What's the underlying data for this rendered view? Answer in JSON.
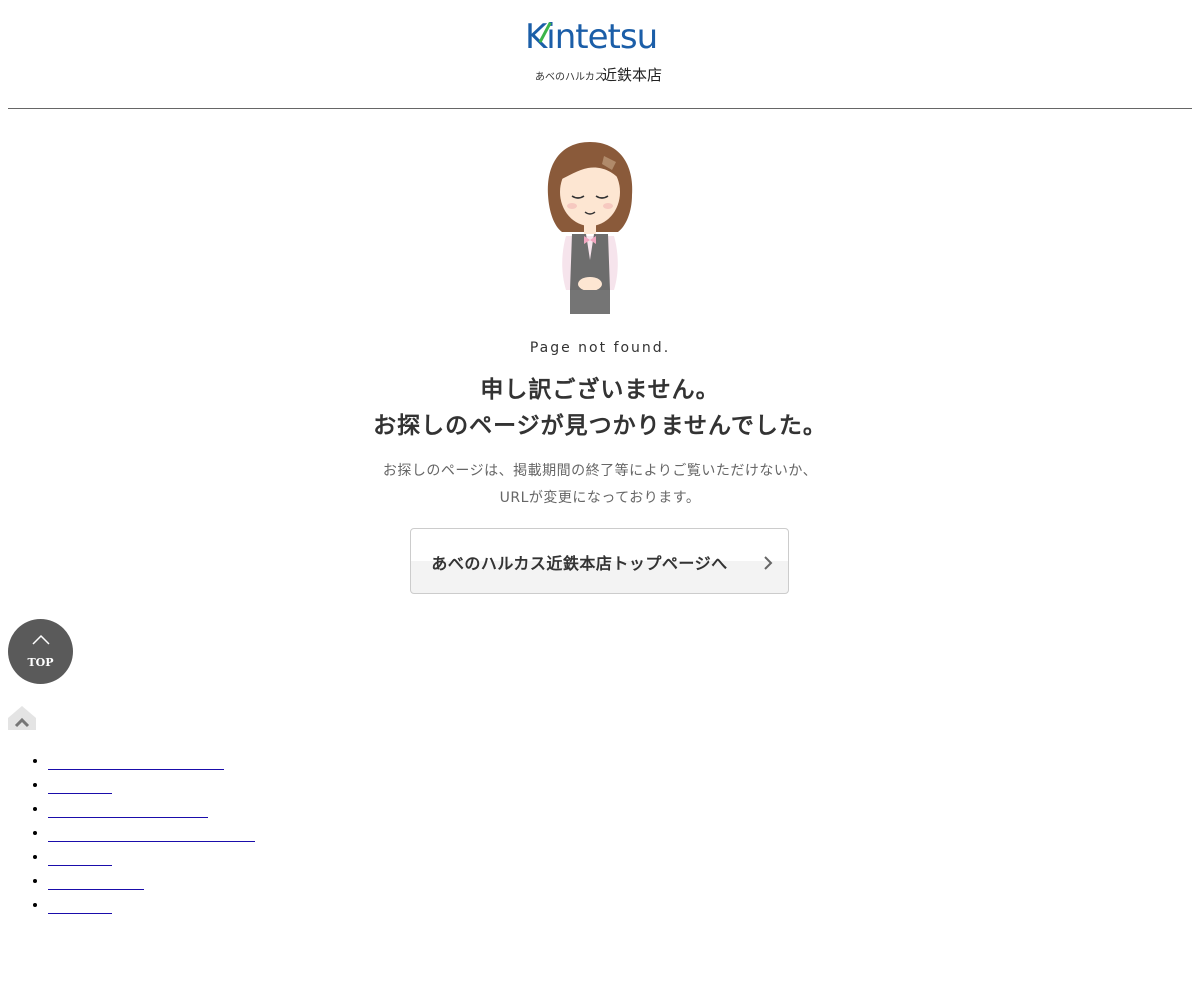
{
  "header": {
    "logo_main": "Kintetsu",
    "logo_sub_small": "あべのハルカス",
    "logo_sub_large": "近鉄本店",
    "brand_blue": "#1b5ea8",
    "brand_green": "#3bb54a"
  },
  "illustration": {
    "icon": "bowing-staff-illustration"
  },
  "main": {
    "not_found": "Page not found.",
    "title_line1": "申し訳ございません。",
    "title_line2": "お探しのページが見つかりませんでした。",
    "desc_line1": "お探しのページは、掲載期間の終了等によりご覧いただけないか、",
    "desc_line2": "URLが変更になっております。",
    "button_label": "あべのハルカス近鉄本店トップページへ"
  },
  "top_button": {
    "label": "TOP",
    "icon": "chevron-up-icon"
  },
  "footer_links": [
    "",
    "",
    "",
    "",
    "",
    "",
    ""
  ]
}
